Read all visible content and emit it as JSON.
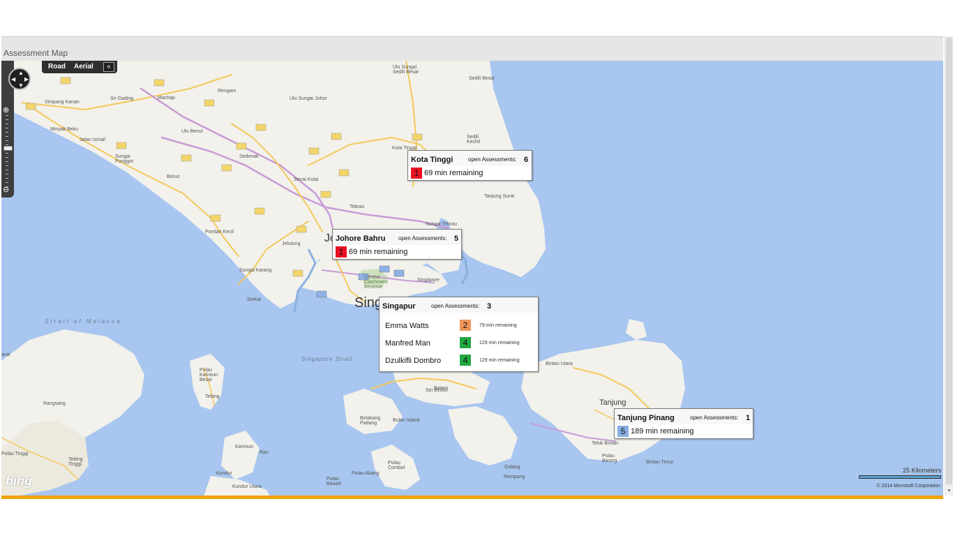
{
  "window": {
    "title": "Assessment Map"
  },
  "map_controls": {
    "type_road": "Road",
    "type_aerial": "Aerial",
    "collapse": "«"
  },
  "attribution": {
    "logo": "bing",
    "scale": "25 Kilometers",
    "copyright": "© 2014 Microsoft Corporation"
  },
  "labels": {
    "rengam": "Rengam",
    "machap": "Machap",
    "simpang_kanan": "Simpang Kanan",
    "sri_gading": "Sri Gading",
    "minyak_beku": "Minyak Beku",
    "jalan_ismail": "Jalan Ismail",
    "sungai_punggor": "Sungai\nPunggor",
    "ulu_benut": "Ulu Benut",
    "benut": "Benut",
    "sedenak": "Sedenak",
    "senai_kulai": "Senai Kulai",
    "ulu_sungai_johor": "Ulu Sungai Johor",
    "ulu_sungai_sedili_besar": "Ulu Sungai\nSedili Besar",
    "sedili_besar": "Sedili Besar",
    "sedili_kechil": "Sedili\nKechil",
    "kota_tinggi": "Kota Tinggi",
    "tebrau": "Tebrau",
    "tanjung_surat": "Tanjung Surat",
    "sungai_tebrau": "Sungai Tebrau",
    "pontian_kecil": "Pontian Kecil",
    "jelutong": "Jelutong",
    "sungai_karang": "Sungai Karang",
    "serkat": "Serkat",
    "johor_bahru": "Jo",
    "singapore_short": "Sing",
    "central_catchment": "Central\nCatchment\nReserve",
    "singapore": "Singapore",
    "strait_malacca": "Strait of Malacca",
    "singapore_strait": "Singapore Strait",
    "bintan_utara": "Bintan Utara",
    "tanjung_pinang": "Tanjung",
    "teluk_bintan": "Teluk Bintan",
    "pulau_basing": "Pulau\nBasing",
    "bintan_timur": "Bintan Timur",
    "sei_beduk": "Sei Beduk",
    "batam": "Batam",
    "bulan_island": "Bulan Island",
    "belakang_padang": "Belakang\nPadang",
    "galang": "Galang",
    "rempang": "Rempang",
    "pulau_combol": "Pulau\nCombol",
    "pulau_abang": "Pulau Abang",
    "pulau_bawah": "Pulau\nBawah",
    "rangsang": "Rangsang",
    "tebing": "Tebing",
    "pulau_karimun_besar": "Pulau\nKarimun\nBesar",
    "karimun": "Karimun",
    "rau": "Rau",
    "kundur_utara": "Kundur Utara",
    "kundur": "Kundur",
    "tebing_tinggi": "Tebing\nTinggi",
    "pulau_tinggi": "Pulau Tinggi",
    "arat": "arat"
  },
  "markers": {
    "kota_tinggi": {
      "title": "Kota Tinggi",
      "open_label": "open Assessments:",
      "open_count": "6",
      "badge": "1",
      "badge_color": "#e81123",
      "remaining": "69 min remaining"
    },
    "johore_bahru": {
      "title": "Johore Bahru",
      "open_label": "open Assessments:",
      "open_count": "5",
      "badge": "1",
      "badge_color": "#e81123",
      "remaining": "69 min remaining"
    },
    "singapur": {
      "title": "Singapur",
      "open_label": "open Assessments:",
      "open_count": "3",
      "people": [
        {
          "name": "Emma Watts",
          "badge": "2",
          "color": "#f0955a",
          "remaining": "79 min remaining"
        },
        {
          "name": "Manfred Man",
          "badge": "4",
          "color": "#21a642",
          "remaining": "129 min remaining"
        },
        {
          "name": "Dzulkifli Dombro",
          "badge": "4",
          "color": "#21a642",
          "remaining": "129 min remaining"
        }
      ]
    },
    "tanjung_pinang": {
      "title": "Tanjung Pinang",
      "open_label": "open Assessments:",
      "open_count": "1",
      "badge": "5",
      "badge_color": "#89aee0",
      "remaining": "189 min remaining"
    }
  },
  "road_shields": [
    "J13",
    "E2",
    "J26",
    "5",
    "J9",
    "J6",
    "1",
    "96",
    "J116",
    "J113",
    "5",
    "E3",
    "E3",
    "E22",
    "94",
    "93",
    "J8",
    "3",
    "E2",
    "J1",
    "15"
  ]
}
